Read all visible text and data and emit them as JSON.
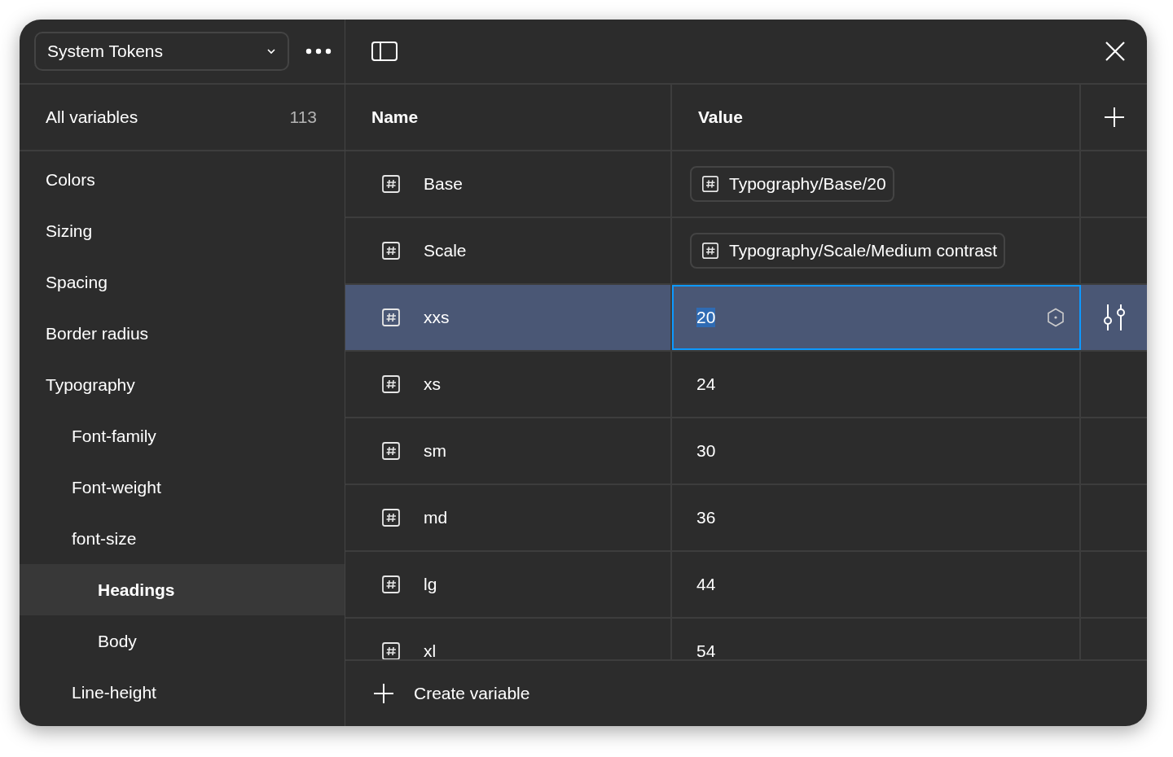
{
  "collection_menu": {
    "label": "System Tokens"
  },
  "sidebar": {
    "all_variables": {
      "label": "All variables",
      "count": "113"
    },
    "items": [
      {
        "label": "Colors",
        "selected": false
      },
      {
        "label": "Sizing",
        "selected": false
      },
      {
        "label": "Spacing",
        "selected": false
      },
      {
        "label": "Border radius",
        "selected": false
      },
      {
        "label": "Typography",
        "selected": false,
        "children": [
          {
            "label": "Font-family",
            "selected": false
          },
          {
            "label": "Font-weight",
            "selected": false
          },
          {
            "label": "font-size",
            "selected": false,
            "children": [
              {
                "label": "Headings",
                "selected": true
              },
              {
                "label": "Body",
                "selected": false
              }
            ]
          },
          {
            "label": "Line-height",
            "selected": false
          }
        ]
      }
    ]
  },
  "table": {
    "columns": [
      "Name",
      "Value"
    ],
    "rows": [
      {
        "name": "Base",
        "kind": "alias",
        "value": "Typography/Base/20",
        "selected": false
      },
      {
        "name": "Scale",
        "kind": "alias",
        "value": "Typography/Scale/Medium contrast",
        "selected": false
      },
      {
        "name": "xxs",
        "kind": "number",
        "value": "20",
        "selected": true
      },
      {
        "name": "xs",
        "kind": "number",
        "value": "24",
        "selected": false
      },
      {
        "name": "sm",
        "kind": "number",
        "value": "30",
        "selected": false
      },
      {
        "name": "md",
        "kind": "number",
        "value": "36",
        "selected": false
      },
      {
        "name": "lg",
        "kind": "number",
        "value": "44",
        "selected": false
      },
      {
        "name": "xl",
        "kind": "number",
        "value": "54",
        "selected": false
      }
    ]
  },
  "footer": {
    "create_label": "Create variable"
  }
}
